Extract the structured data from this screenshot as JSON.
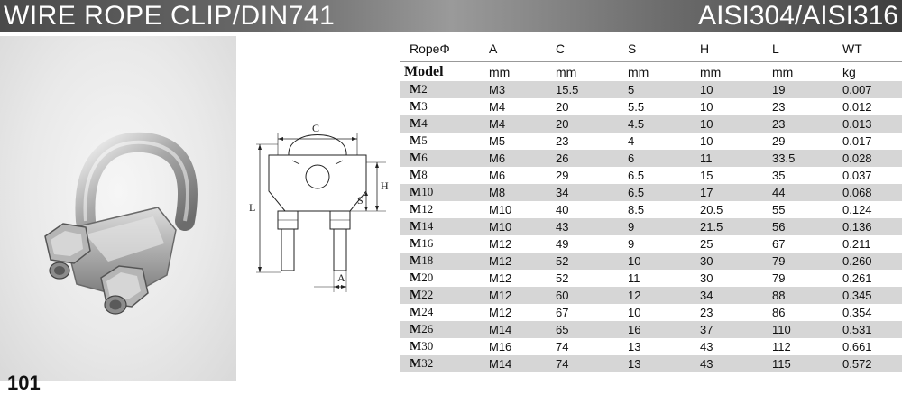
{
  "banner": {
    "title": "WIRE ROPE CLIP/DIN741",
    "material": "AISI304/AISI316"
  },
  "photo": {
    "model_number": "101"
  },
  "diagram": {
    "labels": [
      "C",
      "H",
      "S",
      "L",
      "A"
    ]
  },
  "table": {
    "headers": [
      "RopeΦ",
      "A",
      "C",
      "S",
      "H",
      "L",
      "WT"
    ],
    "units": [
      "Model",
      "mm",
      "mm",
      "mm",
      "mm",
      "mm",
      "kg"
    ],
    "rows": [
      [
        "M2",
        "M3",
        "15.5",
        "5",
        "10",
        "19",
        "0.007"
      ],
      [
        "M3",
        "M4",
        "20",
        "5.5",
        "10",
        "23",
        "0.012"
      ],
      [
        "M4",
        "M4",
        "20",
        "4.5",
        "10",
        "23",
        "0.013"
      ],
      [
        "M5",
        "M5",
        "23",
        "4",
        "10",
        "29",
        "0.017"
      ],
      [
        "M6",
        "M6",
        "26",
        "6",
        "11",
        "33.5",
        "0.028"
      ],
      [
        "M8",
        "M6",
        "29",
        "6.5",
        "15",
        "35",
        "0.037"
      ],
      [
        "M10",
        "M8",
        "34",
        "6.5",
        "17",
        "44",
        "0.068"
      ],
      [
        "M12",
        "M10",
        "40",
        "8.5",
        "20.5",
        "55",
        "0.124"
      ],
      [
        "M14",
        "M10",
        "43",
        "9",
        "21.5",
        "56",
        "0.136"
      ],
      [
        "M16",
        "M12",
        "49",
        "9",
        "25",
        "67",
        "0.211"
      ],
      [
        "M18",
        "M12",
        "52",
        "10",
        "30",
        "79",
        "0.260"
      ],
      [
        "M20",
        "M12",
        "52",
        "11",
        "30",
        "79",
        "0.261"
      ],
      [
        "M22",
        "M12",
        "60",
        "12",
        "34",
        "88",
        "0.345"
      ],
      [
        "M24",
        "M12",
        "67",
        "10",
        "23",
        "86",
        "0.354"
      ],
      [
        "M26",
        "M14",
        "65",
        "16",
        "37",
        "110",
        "0.531"
      ],
      [
        "M30",
        "M16",
        "74",
        "13",
        "43",
        "112",
        "0.661"
      ],
      [
        "M32",
        "M14",
        "74",
        "13",
        "43",
        "115",
        "0.572"
      ]
    ]
  }
}
